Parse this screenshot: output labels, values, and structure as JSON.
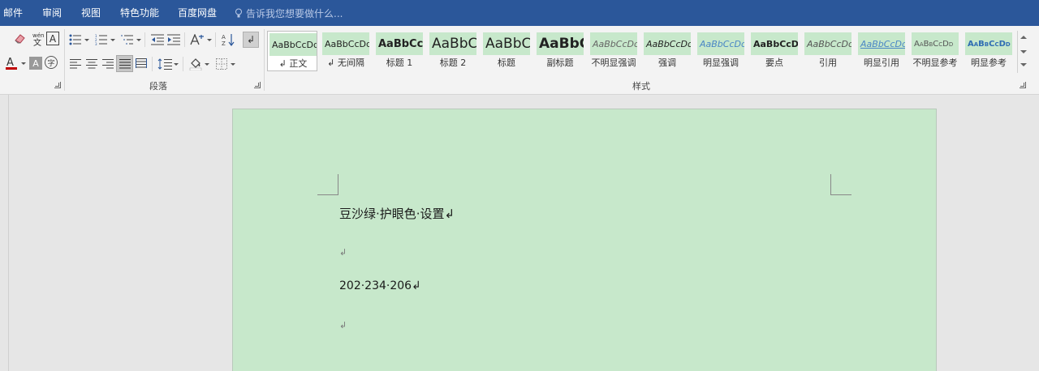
{
  "menu": {
    "items": [
      "邮件",
      "审阅",
      "视图",
      "特色功能",
      "百度网盘"
    ],
    "tell_me": "告诉我您想要做什么..."
  },
  "ribbon": {
    "paragraph_group_label": "段落",
    "styles_group_label": "样式",
    "font_color": "#c00000",
    "styles": [
      {
        "preview": "AaBbCcDd",
        "name": "↲ 正文"
      },
      {
        "preview": "AaBbCcDd",
        "name": "↲ 无间隔"
      },
      {
        "preview": "AaBbCcI",
        "name": "标题 1"
      },
      {
        "preview": "AaBbC",
        "name": "标题 2"
      },
      {
        "preview": "AaBbC",
        "name": "标题"
      },
      {
        "preview": "AaBbC",
        "name": "副标题"
      },
      {
        "preview": "AaBbCcDd",
        "name": "不明显强调"
      },
      {
        "preview": "AaBbCcDd",
        "name": "强调"
      },
      {
        "preview": "AaBbCcDd",
        "name": "明显强调"
      },
      {
        "preview": "AaBbCcDd",
        "name": "要点"
      },
      {
        "preview": "AaBbCcDd",
        "name": "引用"
      },
      {
        "preview": "AaBbCcDd",
        "name": "明显引用"
      },
      {
        "preview": "AaBbCcDd",
        "name": "不明显参考"
      },
      {
        "preview": "AaBbCcDd",
        "name": "明显参考"
      }
    ]
  },
  "document": {
    "page_color": "#c7e8cb",
    "paragraphs": [
      "豆沙绿·护眼色·设置↲",
      "↲",
      "202·234·206↲",
      "↲"
    ]
  }
}
